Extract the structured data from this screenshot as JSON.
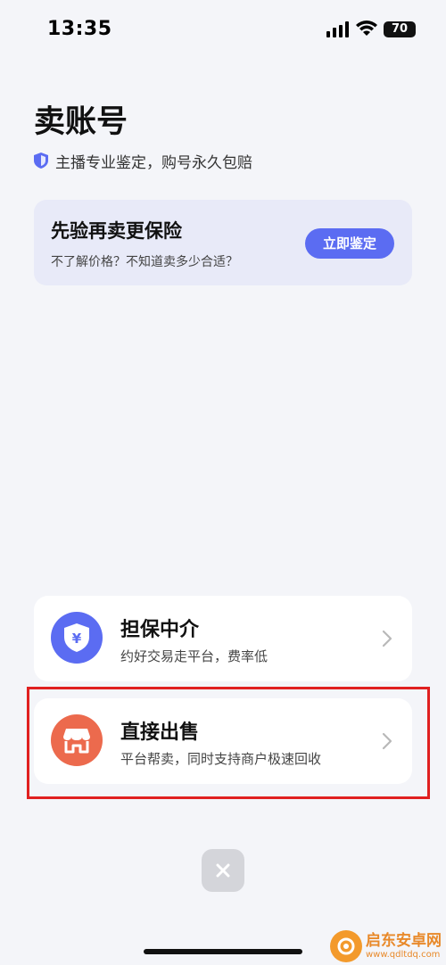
{
  "status_bar": {
    "time": "13:35",
    "battery": "70"
  },
  "header": {
    "title": "卖账号",
    "subtitle": "主播专业鉴定，购号永久包赔"
  },
  "promo": {
    "title": "先验再卖更保险",
    "description": "不了解价格？不知道卖多少合适？",
    "button_label": "立即鉴定"
  },
  "options": [
    {
      "title": "担保中介",
      "description": "约好交易走平台，费率低",
      "icon": "shield-yen-icon",
      "color": "#5b6cf2"
    },
    {
      "title": "直接出售",
      "description": "平台帮卖，同时支持商户极速回收",
      "icon": "storefront-icon",
      "color": "#ec6a4d"
    }
  ],
  "colors": {
    "accent": "#5b6cf2",
    "highlight": "#e02020",
    "background": "#f4f5f9"
  },
  "watermark": {
    "name": "启东安卓网",
    "url": "www.qdltdq.com"
  }
}
